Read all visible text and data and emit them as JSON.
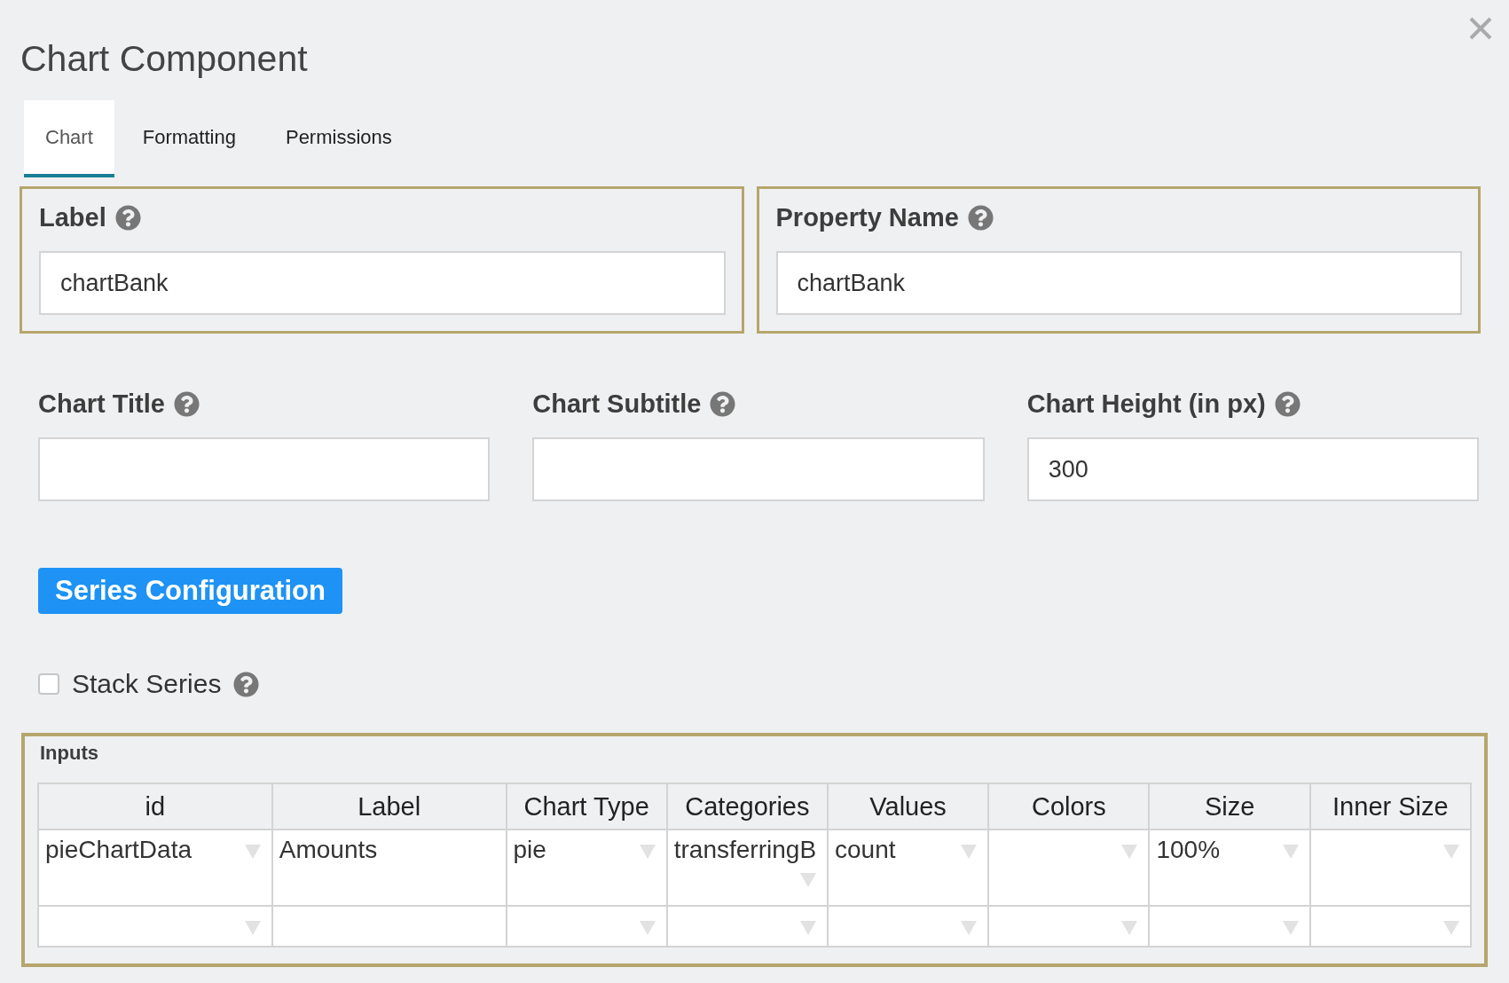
{
  "title": "Chart Component",
  "tabs": [
    {
      "label": "Chart",
      "selected": true
    },
    {
      "label": "Formatting",
      "selected": false
    },
    {
      "label": "Permissions",
      "selected": false
    }
  ],
  "highlighted_fields": [
    {
      "label": "Label",
      "value": "chartBank"
    },
    {
      "label": "Property Name",
      "value": "chartBank"
    }
  ],
  "fields": [
    {
      "label": "Chart Title"
    },
    {
      "label": "Chart Subtitle"
    },
    {
      "label": "Chart Height (in px)",
      "value": "300"
    }
  ],
  "series_button": "Series Configuration",
  "stack_series": {
    "label": "Stack Series",
    "checked": false
  },
  "inputs": {
    "title": "Inputs",
    "columns": [
      {
        "label": "id",
        "kind": "select"
      },
      {
        "label": "Label",
        "kind": "text"
      },
      {
        "label": "Chart Type",
        "kind": "select"
      },
      {
        "label": "Categories",
        "kind": "select"
      },
      {
        "label": "Values",
        "kind": "select"
      },
      {
        "label": "Colors",
        "kind": "select"
      },
      {
        "label": "Size",
        "kind": "select"
      },
      {
        "label": "Inner Size",
        "kind": "select"
      }
    ],
    "rows": [
      [
        "pieChartData",
        "Amounts",
        "pie",
        "transferringB",
        "count",
        null,
        "100%",
        null
      ],
      [
        null,
        null,
        null,
        null,
        null,
        null,
        null,
        null
      ]
    ]
  }
}
